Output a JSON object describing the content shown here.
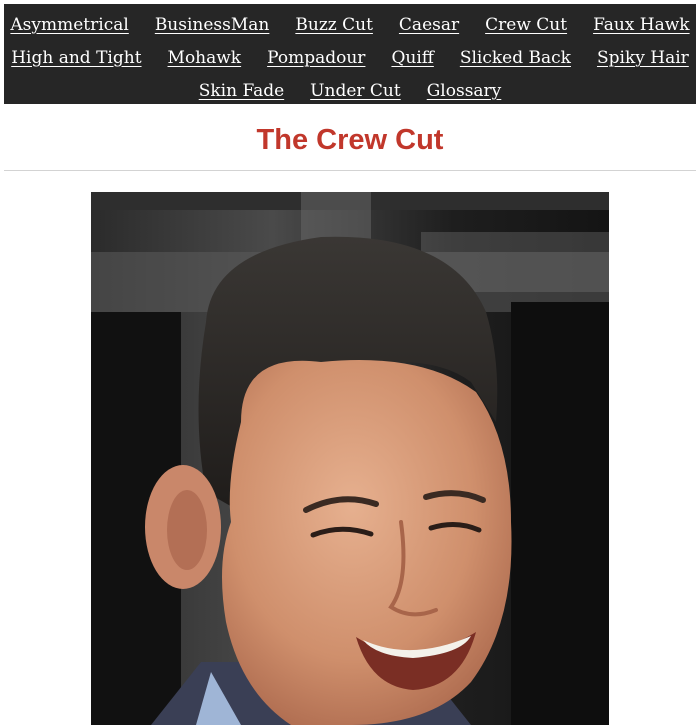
{
  "nav": {
    "rows": [
      [
        "Asymmetrical",
        "BusinessMan",
        "Buzz Cut",
        "Caesar",
        "Crew Cut",
        "Faux Hawk"
      ],
      [
        "High and Tight",
        "Mohawk",
        "Pompadour",
        "Quiff",
        "Slicked Back",
        "Spiky Hair"
      ],
      [
        "Skin Fade",
        "Under Cut",
        "Glossary"
      ]
    ]
  },
  "page": {
    "title": "The Crew Cut"
  },
  "photo": {
    "subject": "man-with-crew-cut-photo"
  },
  "colors": {
    "nav_background": "#262626",
    "title": "#c1372b"
  }
}
